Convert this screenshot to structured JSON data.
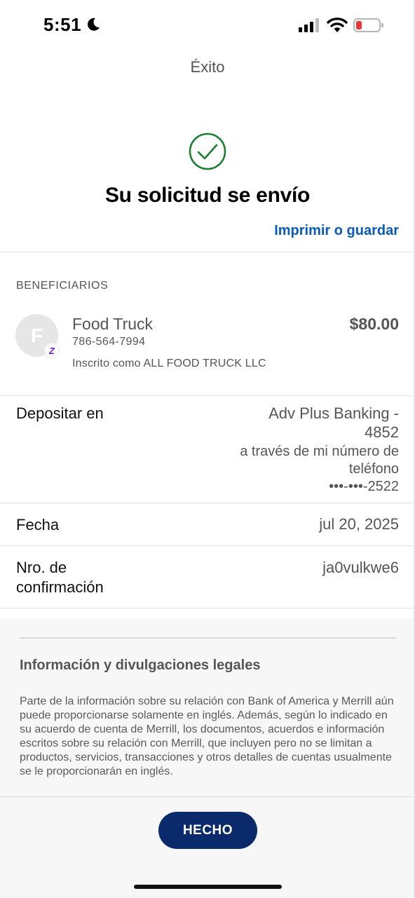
{
  "status_bar": {
    "time": "5:51"
  },
  "nav": {
    "title": "Éxito"
  },
  "success": {
    "headline": "Su solicitud se envío",
    "print_link": "Imprimir o guardar"
  },
  "recipients": {
    "section_label": "BENEFICIARIOS",
    "payee": {
      "initial": "F",
      "name": "Food Truck",
      "phone": "786-564-7994",
      "enrolled": "Inscrito como ALL FOOD TRUCK LLC",
      "amount": "$80.00",
      "badge": "Z"
    }
  },
  "details": {
    "deposit": {
      "label": "Depositar en",
      "account_line1": "Adv Plus Banking -",
      "account_line2": "4852",
      "via_line1": "a través de mi número de",
      "via_line2": "teléfono",
      "masked_phone": "•••-•••-2522"
    },
    "date": {
      "label": "Fecha",
      "value": "jul 20, 2025"
    },
    "confirmation": {
      "label_line1": "Nro. de",
      "label_line2": "confirmación",
      "value": "ja0vulkwe6"
    }
  },
  "legal": {
    "title": "Información y divulgaciones legales",
    "body": "Parte de la información sobre su relación con Bank of America y Merrill aún puede proporcionarse solamente en inglés. Además, según lo indicado en su acuerdo de cuenta de Merrill, los documentos, acuerdos e información escritos sobre su relación con Merrill, que incluyen pero no se limitan a productos, servicios, transacciones y otros detalles de cuentas usualmente se le proporcionarán en inglés."
  },
  "footer": {
    "done_label": "HECHO"
  },
  "icons": {
    "status": [
      "moon-icon",
      "cellular-signal-icon",
      "wifi-icon",
      "battery-icon"
    ],
    "success": "checkmark-circle-icon"
  },
  "colors": {
    "success_green": "#1a7f2e",
    "link_blue": "#0a5bb5",
    "button_navy": "#0a2a6c",
    "zelle_purple": "#6d1ed4",
    "battery_red": "#e53935"
  }
}
